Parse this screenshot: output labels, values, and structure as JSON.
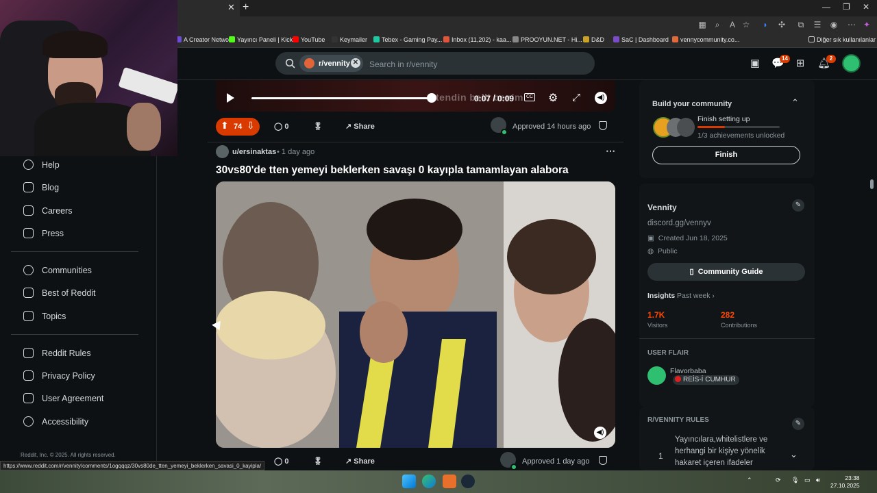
{
  "bookmarks": [
    {
      "label": "A Creator Network",
      "color": "#6e4bd8"
    },
    {
      "label": "Yayıncı Paneli | Kick",
      "color": "#53fc18"
    },
    {
      "label": "YouTube",
      "color": "#ff0000"
    },
    {
      "label": "Keymailer",
      "color": "#333333"
    },
    {
      "label": "Tebex - Gaming Pay...",
      "color": "#1ec8a0"
    },
    {
      "label": "Inbox (11,202) - kaa...",
      "color": "#e0553b"
    },
    {
      "label": "PROOYUN.NET - Hi...",
      "color": "#888888"
    },
    {
      "label": "D&D",
      "color": "#c9a227"
    },
    {
      "label": "SaC | Dashboard",
      "color": "#7b4cc8"
    },
    {
      "label": "vennycommunity.co...",
      "color": "#e06a3a"
    }
  ],
  "bookmarks_other": "Diğer sık kullanılanlar",
  "search": {
    "community_chip": "r/vennity",
    "placeholder": "Search in r/vennity"
  },
  "header_badges": {
    "chat": "14",
    "notifications": "2"
  },
  "leftnav": {
    "group1": [
      {
        "label": "Help",
        "icon": "help-icon"
      },
      {
        "label": "Blog",
        "icon": "blog-icon"
      },
      {
        "label": "Careers",
        "icon": "careers-icon"
      },
      {
        "label": "Press",
        "icon": "press-icon"
      }
    ],
    "group2": [
      {
        "label": "Communities",
        "icon": "communities-icon"
      },
      {
        "label": "Best of Reddit",
        "icon": "best-of-reddit-icon"
      },
      {
        "label": "Topics",
        "icon": "topics-icon"
      }
    ],
    "group3": [
      {
        "label": "Reddit Rules",
        "icon": "rules-icon"
      },
      {
        "label": "Privacy Policy",
        "icon": "privacy-icon"
      },
      {
        "label": "User Agreement",
        "icon": "agreement-icon"
      },
      {
        "label": "Accessibility",
        "icon": "accessibility-icon"
      }
    ],
    "footer": "Reddit, Inc. © 2025. All rights reserved."
  },
  "post1": {
    "video_time": "0:07 / 0:09",
    "video_progress": 0.78,
    "votes": "74",
    "comments": "0",
    "share": "Share",
    "approved": "Approved 14 hours ago"
  },
  "post2": {
    "author": "u/ersinaktas",
    "time": "• 1 day ago",
    "title": "30vs80'de tten yemeyi beklerken savaşı 0 kayıpla tamamlayan alabora",
    "comments": "0",
    "share": "Share",
    "approved": "Approved 1 day ago"
  },
  "build_card": {
    "title": "Build your community",
    "subtitle": "Finish setting up",
    "progress_text": "1/3 achievements unlocked",
    "progress": 0.33,
    "button": "Finish"
  },
  "community": {
    "name": "Vennity",
    "link": "discord.gg/vennyv",
    "created": "Created Jun 18, 2025",
    "visibility": "Public",
    "guide_button": "Community Guide",
    "insights_label": "Insights",
    "insights_period": "Past week",
    "visitors_value": "1.7K",
    "visitors_label": "Visitors",
    "contributions_value": "282",
    "contributions_label": "Contributions",
    "accent": "#ff4500"
  },
  "user_flair": {
    "heading": "USER FLAIR",
    "username": "Flavorbaba",
    "flair": "REİS-İ CUMHUR"
  },
  "rules": {
    "heading": "R/VENNITY RULES",
    "items": [
      {
        "number": "1",
        "text": "Yayıncılara,whitelistlere ve herhangi bir kişiye yönelik hakaret içeren ifadeler"
      }
    ]
  },
  "status_url": "https://www.reddit.com/r/vennity/comments/1ogqqqz/30vs80de_tten_yemeyi_beklerken_savasi_0_kayipla/",
  "clock": {
    "time": "23:38",
    "date": "27.10.2025"
  }
}
